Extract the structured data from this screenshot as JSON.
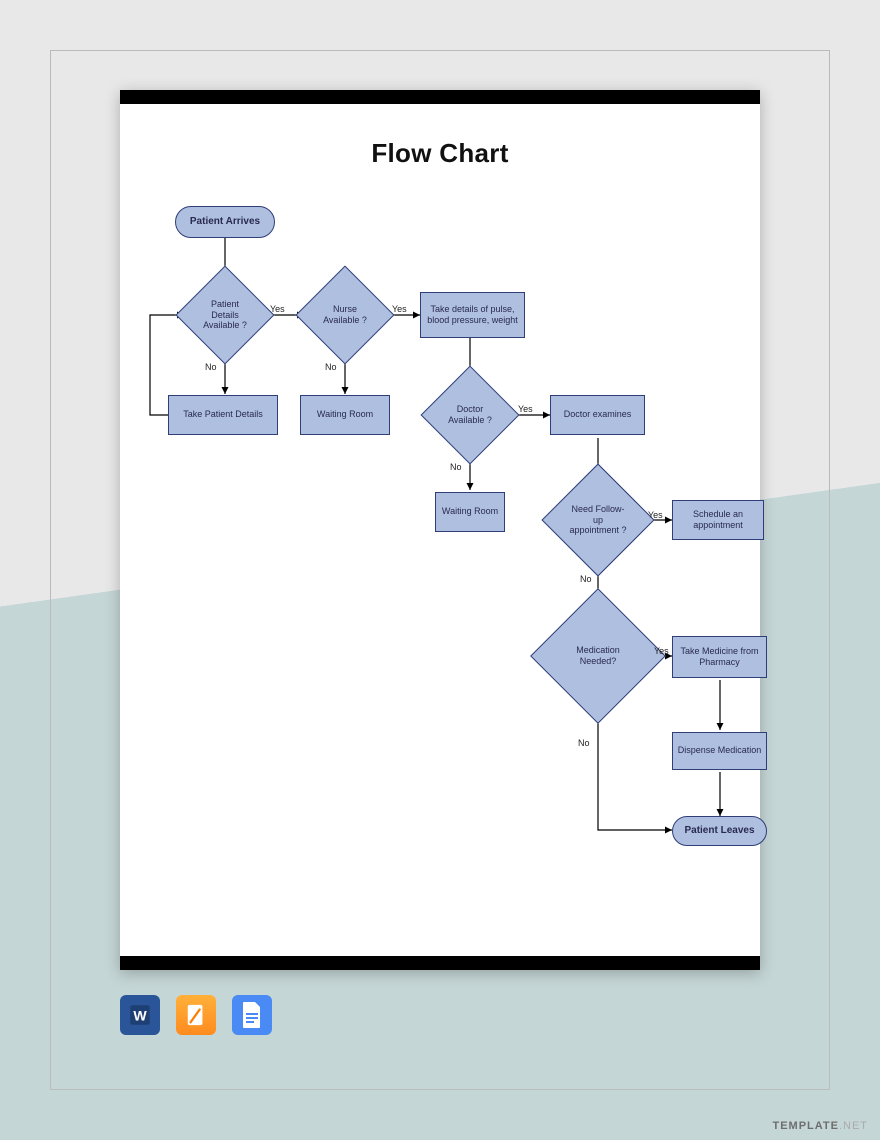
{
  "title": "Flow Chart",
  "nodes": {
    "start": "Patient Arrives",
    "d_patient_details": "Patient Details Available ?",
    "p_take_details": "Take Patient Details",
    "d_nurse": "Nurse Available ?",
    "p_wait1": "Waiting Room",
    "p_vitals": "Take details of pulse, blood pressure, weight",
    "d_doctor": "Doctor Available ?",
    "p_wait2": "Waiting Room",
    "p_examine": "Doctor examines",
    "d_followup": "Need Follow-up appointment ?",
    "p_schedule": "Schedule an appointment",
    "d_medication": "Medication Needed?",
    "p_take_med": "Take Medicine from Pharmacy",
    "p_dispense": "Dispense Medication",
    "end": "Patient Leaves"
  },
  "labels": {
    "yes": "Yes",
    "no": "No"
  },
  "formats": {
    "word": "Microsoft Word",
    "pages": "Apple Pages",
    "docs": "Google Docs"
  },
  "watermark_brand": "TEMPLATE",
  "watermark_tld": ".NET",
  "colors": {
    "shape_fill": "#aebfe0",
    "shape_border": "#2f3d78"
  }
}
